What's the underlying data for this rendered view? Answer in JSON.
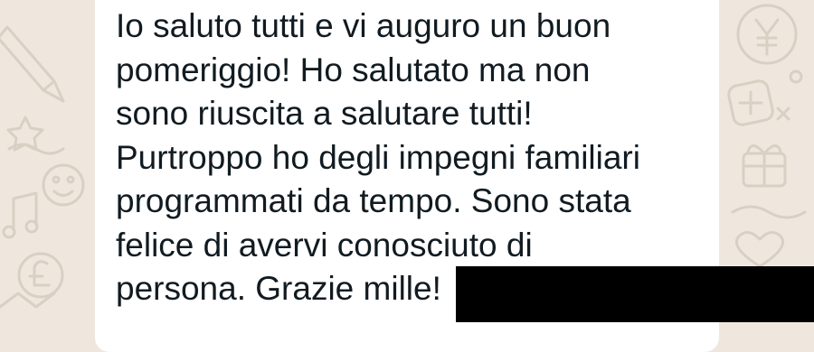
{
  "message": {
    "lines": [
      "Io saluto tutti e vi auguro un buon",
      "pomeriggio! Ho salutato ma non",
      "sono riuscita a salutare tutti!",
      "Purtroppo ho degli impegni familiari",
      "programmati da tempo. Sono stata",
      "felice di avervi conosciuto di",
      "persona. Grazie mille!"
    ]
  },
  "colors": {
    "wallpaper": "#efe7de",
    "wallpaper_doodle": "#d9cfc3",
    "bubble": "#ffffff",
    "text": "#111b21",
    "redaction": "#000000"
  },
  "icons": {
    "wallpaper": [
      "pencil-doodle-icon",
      "yen-coin-doodle-icon",
      "plus-badge-doodle-icon",
      "pound-coin-doodle-icon",
      "star-doodle-icon",
      "music-note-doodle-icon"
    ]
  }
}
